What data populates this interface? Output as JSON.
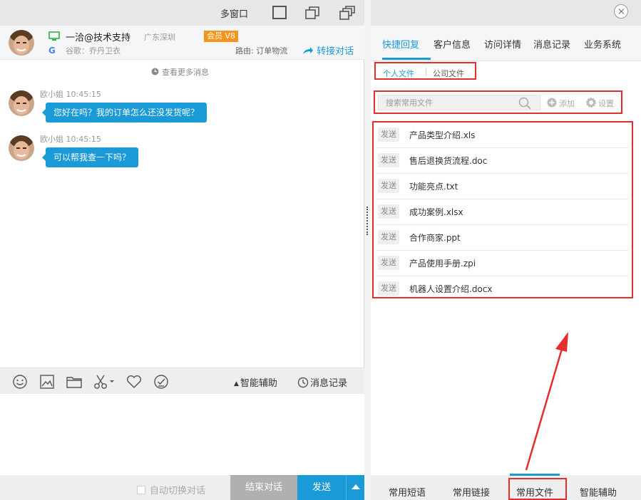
{
  "window": {
    "multi_window_label": "多窗口"
  },
  "visitor": {
    "name": "一洽@技术支持",
    "location": "广东深圳",
    "source": "谷歌：乔丹卫衣",
    "badge": "会员 V8",
    "route": "路由: 订单物流",
    "transfer_label": "转接对话"
  },
  "chat": {
    "more_messages": "查看更多消息",
    "messages": [
      {
        "sender": "欧小姐",
        "time": "10:45:15",
        "text": "您好在吗？我的订单怎么还没发货呢？"
      },
      {
        "sender": "欧小姐",
        "time": "10:45:15",
        "text": "可以帮我查一下吗？"
      }
    ]
  },
  "toolbar": {
    "smart_assist": "智能辅助",
    "history": "消息记录"
  },
  "footer": {
    "auto_switch": "自动切换对话",
    "end_label": "结束对话",
    "send_label": "发送"
  },
  "right": {
    "tabs": [
      "快捷回复",
      "客户信息",
      "访问详情",
      "消息记录",
      "业务系统"
    ],
    "active_tab": "快捷回复",
    "sub_tabs": [
      "个人文件",
      "公司文件"
    ],
    "search_placeholder": "搜索常用文件",
    "add_label": "添加",
    "settings_label": "设置",
    "send_tag": "发送",
    "files": [
      "产品类型介绍.xls",
      "售后退换货流程.doc",
      "功能亮点.txt",
      "成功案例.xlsx",
      "合作商家.ppt",
      "产品使用手册.zpi",
      "机器人设置介绍.docx"
    ],
    "bottom_tabs": [
      "常用短语",
      "常用链接",
      "常用文件",
      "智能辅助"
    ],
    "active_bottom_tab": "常用文件"
  },
  "colors": {
    "accent": "#1a9ad7",
    "highlight": "#e52d2d",
    "badge": "#f7941d"
  }
}
